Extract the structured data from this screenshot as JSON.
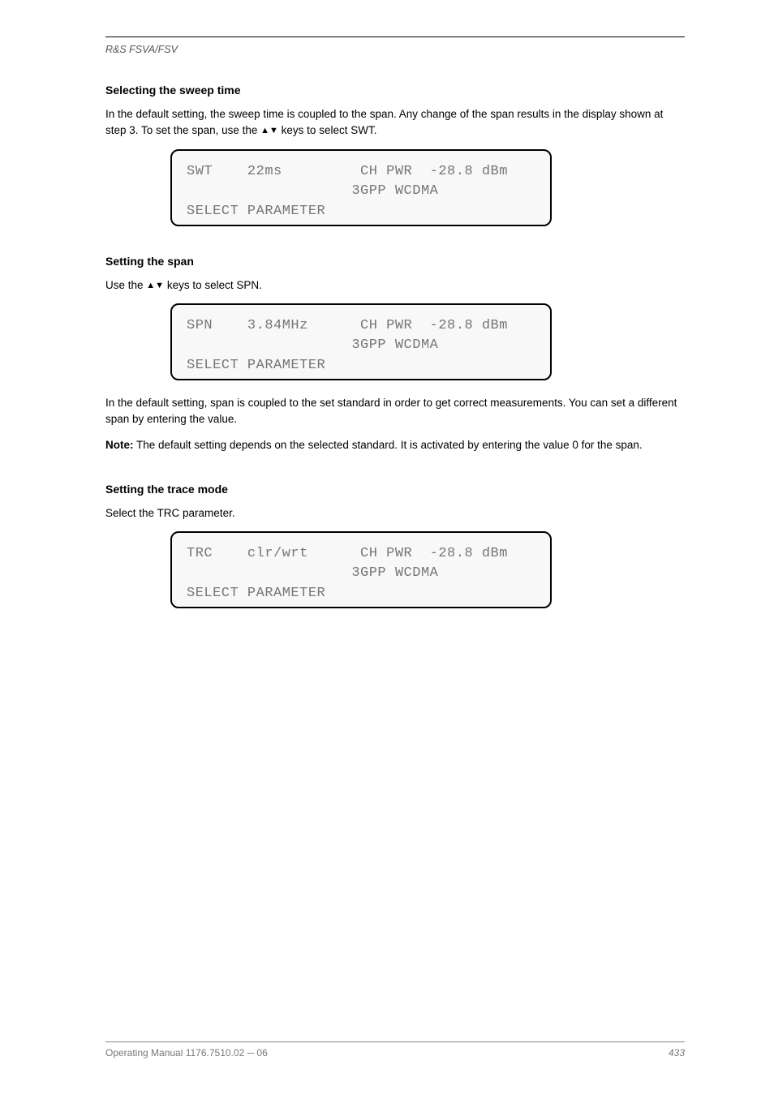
{
  "header": {
    "breadcrumb": "R&S FSVA/FSV"
  },
  "section1": {
    "heading": "Selecting the sweep time",
    "para": "In the default setting, the sweep time is coupled to the span. Any change of the span results in the display shown at step 3. To set the span, use the ▲▼ keys to select SWT.",
    "lcd": {
      "line1": "SWT    22ms         CH PWR  -28.8 dBm",
      "line2": "                   3GPP WCDMA",
      "line3": "SELECT PARAMETER"
    }
  },
  "section2": {
    "heading": "Setting the span",
    "para1": "Use the ▲▼ keys to select SPN.",
    "lcd": {
      "line1": "SPN    3.84MHz      CH PWR  -28.8 dBm",
      "line2": "                   3GPP WCDMA",
      "line3": "SELECT PARAMETER"
    },
    "para2": "In the default setting, span is coupled to the set standard in order to get correct measurements. You can set a different span by entering the value.",
    "note_label": "Note:",
    "note_text": " The default setting depends on the selected standard. It is activated by entering the value 0 for the span."
  },
  "section3": {
    "heading": "Setting the trace mode",
    "para": "Select the TRC parameter.",
    "lcd": {
      "line1": "TRC    clr/wrt      CH PWR  -28.8 dBm",
      "line2": "                   3GPP WCDMA",
      "line3": "SELECT PARAMETER"
    }
  },
  "footer": {
    "left": "Operating Manual 1176.7510.02 ─ 06",
    "right": "433"
  }
}
